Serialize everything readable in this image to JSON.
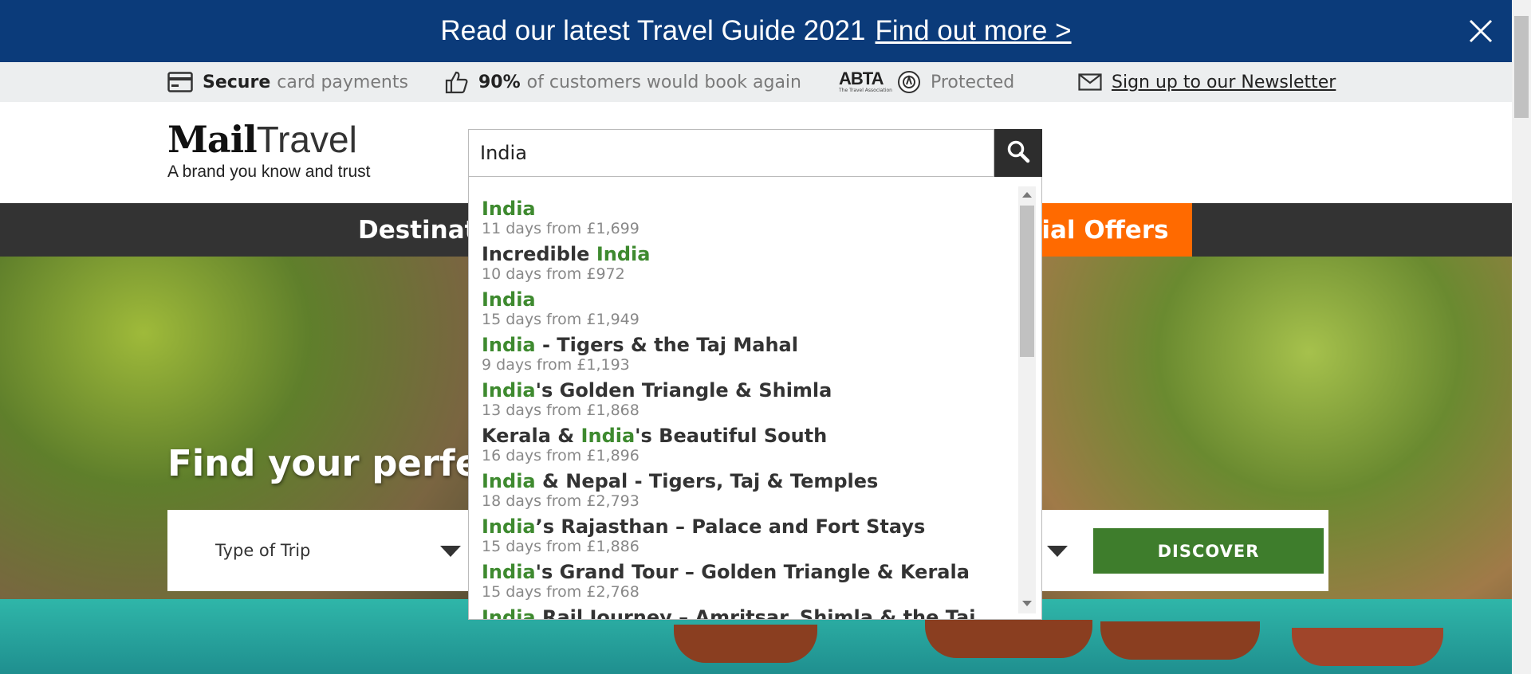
{
  "banner": {
    "text": "Read our latest Travel Guide 2021",
    "link": "Find out more >"
  },
  "trust_bar": {
    "secure_bold": "Secure",
    "secure_rest": "card payments",
    "rating_bold": "90%",
    "rating_rest": "of customers would book again",
    "abta_logo": "ABTA",
    "abta_sub": "The Travel Association",
    "protected": "Protected",
    "newsletter": "Sign up to our Newsletter",
    "icons": [
      "credit-card-icon",
      "thumbs-up-icon",
      "abta-logo",
      "mail-icon"
    ]
  },
  "header": {
    "logo_mail": "Mail",
    "logo_travel": "Travel",
    "tagline": "A brand you know and trust"
  },
  "search": {
    "value": "India",
    "button_icon": "search-icon"
  },
  "nav": {
    "destinations": "Destinat",
    "offers": "cial Offers"
  },
  "hero": {
    "title": "Find your perfect",
    "type_of_trip": "Type of Trip",
    "discover": "DISCOVER"
  },
  "suggestions": [
    {
      "pre": "",
      "hl": "India",
      "post": "",
      "meta": "11 days from £1,699"
    },
    {
      "pre": "Incredible ",
      "hl": "India",
      "post": "",
      "meta": "10 days from £972"
    },
    {
      "pre": "",
      "hl": "India",
      "post": "",
      "meta": "15 days from £1,949"
    },
    {
      "pre": "",
      "hl": "India",
      "post": " - Tigers & the Taj Mahal",
      "meta": "9 days from £1,193"
    },
    {
      "pre": "",
      "hl": "India",
      "post": "'s Golden Triangle & Shimla",
      "meta": "13 days from £1,868"
    },
    {
      "pre": "Kerala & ",
      "hl": "India",
      "post": "'s Beautiful South",
      "meta": "16 days from £1,896"
    },
    {
      "pre": "",
      "hl": "India",
      "post": " & Nepal - Tigers, Taj & Temples",
      "meta": "18 days from £2,793"
    },
    {
      "pre": "",
      "hl": "India",
      "post": "’s Rajasthan – Palace and Fort Stays",
      "meta": "15 days from £1,886"
    },
    {
      "pre": "",
      "hl": "India",
      "post": "'s Grand Tour – Golden Triangle & Kerala",
      "meta": "15 days from £2,768"
    },
    {
      "pre": "",
      "hl": "India",
      "post": " Rail Journey – Amritsar, Shimla & the Taj",
      "meta": ""
    }
  ],
  "colors": {
    "banner": "#0b3b7a",
    "nav": "#333333",
    "offers": "#ff6a00",
    "highlight": "#3e8a2f",
    "discover": "#3e7d2c"
  }
}
